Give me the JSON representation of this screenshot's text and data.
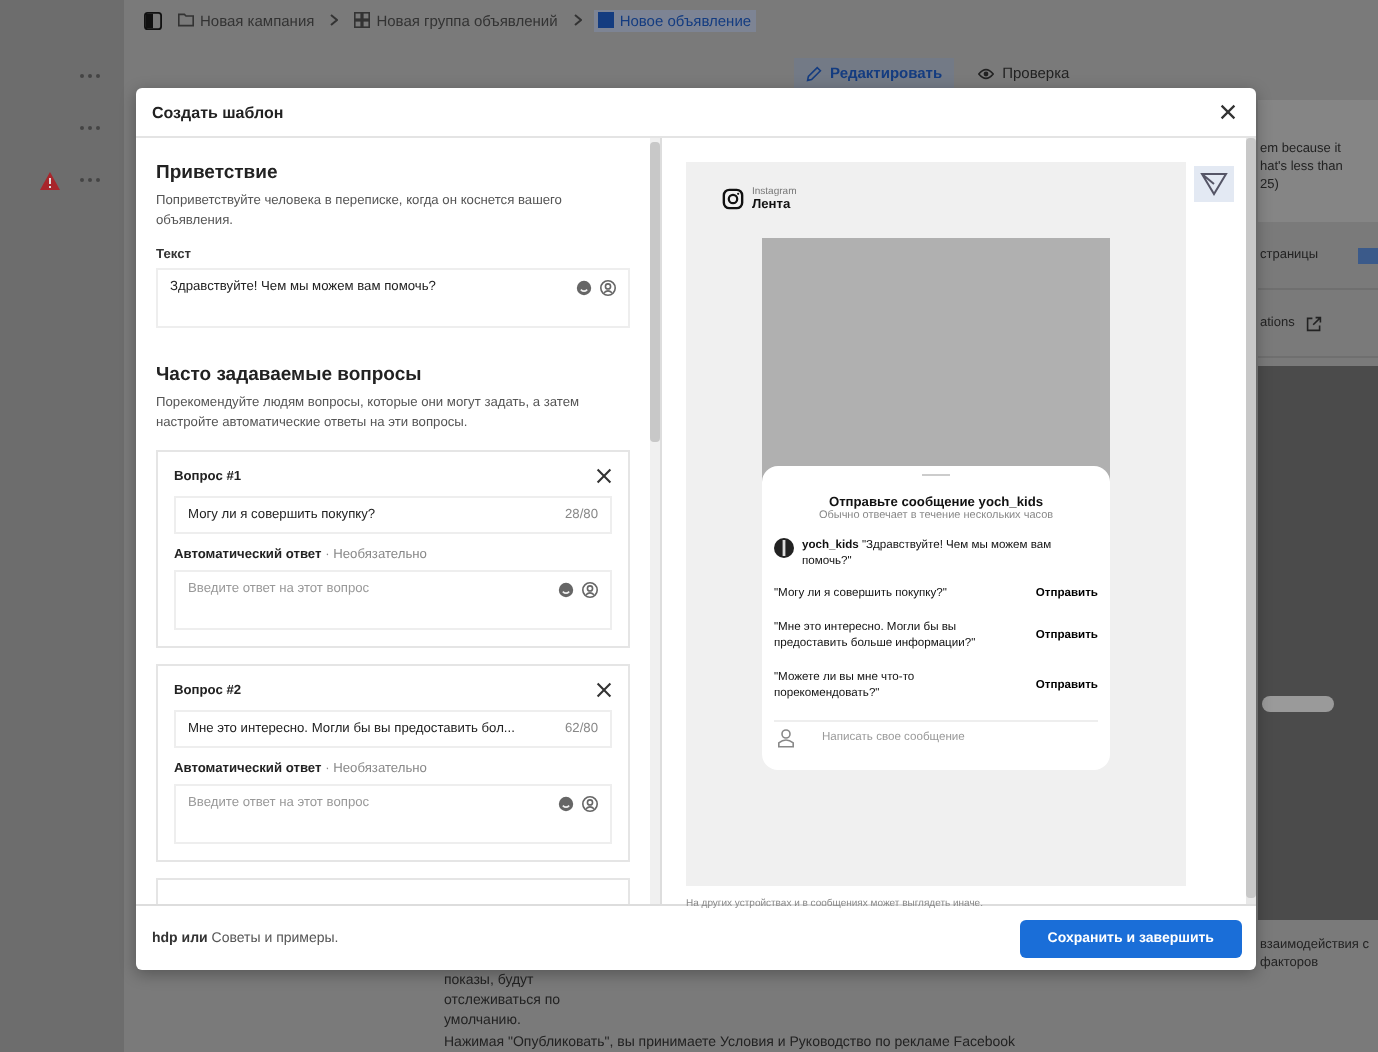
{
  "background": {
    "breadcrumbs": [
      {
        "label": "Новая кампания",
        "kind": "folder",
        "selected": false
      },
      {
        "label": "Новая группа объявлений",
        "kind": "grid",
        "selected": false
      },
      {
        "label": "Новое объявление",
        "kind": "square",
        "selected": true
      }
    ],
    "mode_tabs": [
      {
        "label": "Редактировать",
        "kind": "edit",
        "selected": true
      },
      {
        "label": "Проверка",
        "kind": "eye",
        "selected": false
      }
    ],
    "side_rows": [
      {
        "warning": false
      },
      {
        "warning": false
      },
      {
        "warning": true
      }
    ],
    "notice_lines": [
      "em because it",
      "hat's less than",
      "25)"
    ],
    "page_label": "страницы",
    "integrations_label": "ations",
    "side_note_lines": [
      "взаимодействия с",
      "факторов"
    ],
    "bottom_note_lines": [
      "показы, будут",
      "отслеживаться по",
      "умолчанию."
    ],
    "terms": "Нажимая \"Опубликовать\", вы принимаете Условия и Руководство по рекламе Facebook"
  },
  "modal": {
    "title": "Создать шаблон",
    "greeting": {
      "heading": "Приветствие",
      "description": "Поприветствуйте человека в переписке, когда он коснется вашего объявления.",
      "field_label": "Текст",
      "value": "Здравствуйте! Чем мы можем вам помочь?"
    },
    "faq": {
      "heading": "Часто задаваемые вопросы",
      "description": "Порекомендуйте людям вопросы, которые они могут задать, а затем настройте автоматические ответы на эти вопросы.",
      "questions": [
        {
          "title": "Вопрос #1",
          "value": "Могу ли я совершить покупку?",
          "counter": "28/80",
          "answer_label": "Автоматический ответ",
          "answer_hint": "· Необязательно",
          "answer_placeholder": "Введите ответ на этот вопрос"
        },
        {
          "title": "Вопрос #2",
          "value": "Мне это интересно. Могли бы вы предоставить бол...",
          "counter": "62/80",
          "answer_label": "Автоматический ответ",
          "answer_hint": "· Необязательно",
          "answer_placeholder": "Введите ответ на этот вопрос"
        }
      ]
    },
    "preview": {
      "platform": "Instagram",
      "placement": "Лента",
      "sheet_title": "Отправьте сообщение yoch_kids",
      "sheet_subtitle": "Обычно отвечает в течение нескольких часов",
      "account": "yoch_kids",
      "greeting": "\"Здравствуйте! Чем мы можем вам помочь?\"",
      "questions": [
        {
          "text": "\"Могу ли я совершить покупку?\"",
          "action": "Отправить"
        },
        {
          "text": "\"Мне это интересно. Могли бы вы предоставить больше информации?\"",
          "action": "Отправить"
        },
        {
          "text": "\"Можете ли вы мне что-то порекомендовать?\"",
          "action": "Отправить"
        }
      ],
      "input_placeholder": "Написать свое сообщение",
      "note": "На других устройствах и в сообщениях может выглядеть иначе."
    },
    "footer": {
      "prefix": "hdp или",
      "link": "Советы и примеры."
    },
    "primary_button": "Сохранить и завершить"
  }
}
